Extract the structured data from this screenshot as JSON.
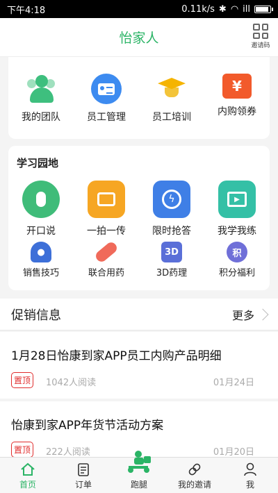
{
  "status_bar": {
    "time": "下午4:18",
    "speed": "0.11k/s",
    "signal": "ill"
  },
  "header": {
    "title": "怡家人",
    "invite_label": "邀请码"
  },
  "top_grid": [
    {
      "label": "我的团队",
      "icon": "team-icon"
    },
    {
      "label": "员工管理",
      "icon": "staff-card-icon"
    },
    {
      "label": "员工培训",
      "icon": "graduation-cap-icon"
    },
    {
      "label": "内购领券",
      "icon": "coupon-icon",
      "glyph": "¥"
    }
  ],
  "learning": {
    "title": "学习园地",
    "row1": [
      {
        "label": "开口说",
        "icon": "microphone-icon"
      },
      {
        "label": "一拍一传",
        "icon": "camera-icon"
      },
      {
        "label": "限时抢答",
        "icon": "stopwatch-icon"
      },
      {
        "label": "我学我练",
        "icon": "play-video-icon"
      }
    ],
    "row2": [
      {
        "label": "销售技巧",
        "icon": "sales-person-icon"
      },
      {
        "label": "联合用药",
        "icon": "pill-icon"
      },
      {
        "label": "3D药理",
        "icon": "3d-cube-icon",
        "glyph": "3D"
      },
      {
        "label": "积分福利",
        "icon": "points-gift-icon",
        "glyph": "积"
      }
    ]
  },
  "promo": {
    "title": "促销信息",
    "more": "更多"
  },
  "news": [
    {
      "title": "1月28日怡康到家APP员工内购产品明细",
      "pin": "置顶",
      "reads": "1042人阅读",
      "date": "01月24日"
    },
    {
      "title": "怡康到家APP年货节活动方案",
      "pin": "置顶",
      "reads": "222人阅读",
      "date": "01月20日"
    }
  ],
  "nav": [
    {
      "label": "首页",
      "icon": "home-icon",
      "active": true
    },
    {
      "label": "订单",
      "icon": "order-list-icon"
    },
    {
      "label": "跑腿",
      "icon": "delivery-rider-icon"
    },
    {
      "label": "我的邀请",
      "icon": "link-icon"
    },
    {
      "label": "我",
      "icon": "profile-icon"
    }
  ],
  "colors": {
    "brand_green": "#2bb466",
    "pin_red": "#e02b2b"
  }
}
